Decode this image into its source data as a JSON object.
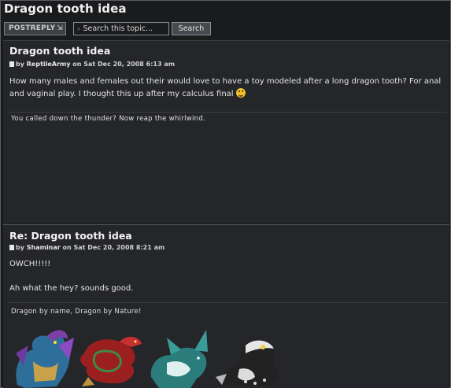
{
  "topic": {
    "title": "Dragon tooth idea"
  },
  "toolbar": {
    "postreply_label": "POSTREPLY",
    "postreply_arrow": "⇲",
    "search_placeholder": "Search this topic...",
    "search_button": "Search"
  },
  "posts": [
    {
      "title": "Dragon tooth idea",
      "by": "by",
      "author": "ReptileArmy",
      "date": "on Sat Dec 20, 2008 6:13 am",
      "content": "How many males and females out their would love to have a toy modeled after a long dragon tooth? For anal and vaginal play. I thought this up after my calculus final",
      "signature": "You called down the thunder? Now reap the whirlwind."
    },
    {
      "title": "Re: Dragon tooth idea",
      "by": "by",
      "author": "Shaminar",
      "date": "on Sat Dec 20, 2008 8:21 am",
      "line1": "OWCH!!!!!",
      "line2": "Ah what the hey? sounds good.",
      "signature": "Dragon by name, Dragon by Nature!"
    }
  ],
  "icons": {
    "post_icon": "document-icon",
    "smiley": "laughing-smiley-icon",
    "search": "search-icon"
  },
  "colors": {
    "background": "#1a1b1d",
    "post_bg": "#252629",
    "text": "#e4e4e4"
  }
}
